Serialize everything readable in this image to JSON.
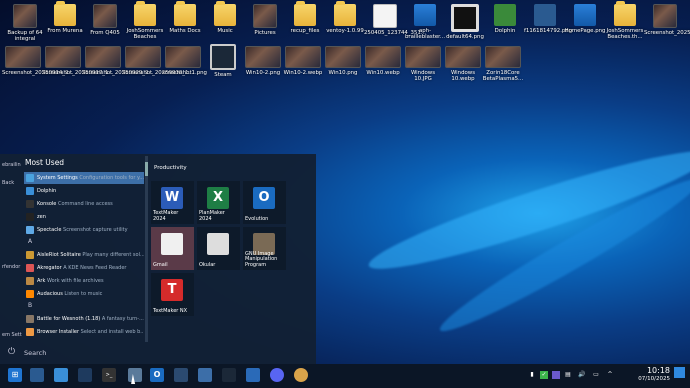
{
  "desktop": {
    "row1": [
      "Backup of 64 integral",
      "From Murena",
      "From Q405",
      "JoshSommers Beaches",
      "Maths Docs",
      "Music",
      "Pictures",
      "recup_files",
      "ventoy-1.0.99",
      "250405_123744_351...",
      "aph-brailleblaster...",
      "default64.png",
      "Dolphin",
      "f1161814792.png",
      "HomePage.png",
      "JoshSommers Beaches.th...",
      "Screenshot_20250410_0..."
    ],
    "row2": [
      "Screenshot_20250914_2...",
      "Screenshot_20250917_1...",
      "Screenshot_20250929_2...",
      "Screenshot_20250930_1...",
      "screenshot1.png",
      "Steam",
      "Win10-2.png",
      "Win10-2.webp",
      "Win10.png",
      "Win10.webp",
      "Windows 10.JPG",
      "Windows 10.webp",
      "Zorin18Core BetaPlasma5..."
    ]
  },
  "menu": {
    "section_title": "Most Used",
    "left_strip": [
      "ebrailin",
      "Back",
      "rfendor",
      "em Sett"
    ],
    "items": [
      {
        "name": "System Settings",
        "desc": "Configuration tools for y...",
        "color": "#4aa3df",
        "selected": true
      },
      {
        "name": "Dolphin",
        "desc": "",
        "color": "#3a8fd8"
      },
      {
        "name": "Konsole",
        "desc": "Command line access",
        "color": "#333"
      },
      {
        "name": "zen",
        "desc": "",
        "color": "#222"
      },
      {
        "name": "Spectacle",
        "desc": "Screenshot capture utility",
        "color": "#5fa9e6"
      }
    ],
    "letter_a": "A",
    "items_a": [
      {
        "name": "AisleRiot Solitaire",
        "desc": "Play many different sol...",
        "color": "#c93"
      },
      {
        "name": "Akregator",
        "desc": "A KDE News Feed Reader",
        "color": "#d55"
      },
      {
        "name": "Ark",
        "desc": "Work with file archives",
        "color": "#b84"
      },
      {
        "name": "Audacious",
        "desc": "Listen to music",
        "color": "#f80"
      }
    ],
    "letter_b": "B",
    "items_b": [
      {
        "name": "Battle for Wesnoth (1.18)",
        "desc": "A fantasy turn-...",
        "color": "#876"
      },
      {
        "name": "Browser Installer",
        "desc": "Select and install web b...",
        "color": "#e94"
      }
    ],
    "productivity_title": "Productivity",
    "tiles": [
      {
        "label": "TextMaker 2024",
        "glyph": "W",
        "bg": "#2b5cb8"
      },
      {
        "label": "PlanMaker 2024",
        "glyph": "X",
        "bg": "#1e7e45"
      },
      {
        "label": "Evolution",
        "glyph": "O",
        "bg": "#1a6bc0"
      },
      {
        "label": "Gmail",
        "glyph": "",
        "bg": "#f0f0f0"
      },
      {
        "label": "Okular",
        "glyph": "",
        "bg": "#ddd"
      },
      {
        "label": "GNU Image Manipulation Program",
        "glyph": "",
        "bg": "#7a6a55"
      },
      {
        "label": "TextMaker NX",
        "glyph": "T",
        "bg": "#d52b2b"
      }
    ],
    "search_placeholder": "Search"
  },
  "taskbar": {
    "time": "10:18",
    "date": "07/10/2025"
  }
}
